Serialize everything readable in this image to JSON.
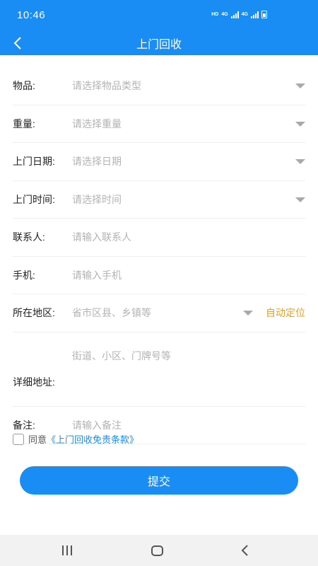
{
  "status_bar": {
    "time": "10:46",
    "hd": "HD",
    "net1": "4G",
    "net2": "4G"
  },
  "header": {
    "title": "上门回收"
  },
  "form": {
    "fields": [
      {
        "label": "物品:",
        "placeholder": "请选择物品类型"
      },
      {
        "label": "重量:",
        "placeholder": "请选择重量"
      },
      {
        "label": "上门日期:",
        "placeholder": "请选择日期"
      },
      {
        "label": "上门时间:",
        "placeholder": "请选择时间"
      },
      {
        "label": "联系人:",
        "placeholder": "请输入联系人"
      },
      {
        "label": "手机:",
        "placeholder": "请输入手机"
      },
      {
        "label": "所在地区:",
        "placeholder": "省市区县、乡镇等",
        "action": "自动定位"
      },
      {
        "label": "详细地址:",
        "placeholder": "街道、小区、门牌号等"
      },
      {
        "label": "备注:",
        "placeholder": "请输入备注"
      }
    ]
  },
  "agreement": {
    "prefix": "同意",
    "link": "《上门回收免责条款》",
    "checked": false
  },
  "submit_label": "提交",
  "colors": {
    "primary": "#1a8df5",
    "accent": "#e6a020",
    "placeholder": "#b3b3b3"
  },
  "icons": {
    "back": "chevron-left-icon",
    "dropdown": "caret-down-icon"
  }
}
